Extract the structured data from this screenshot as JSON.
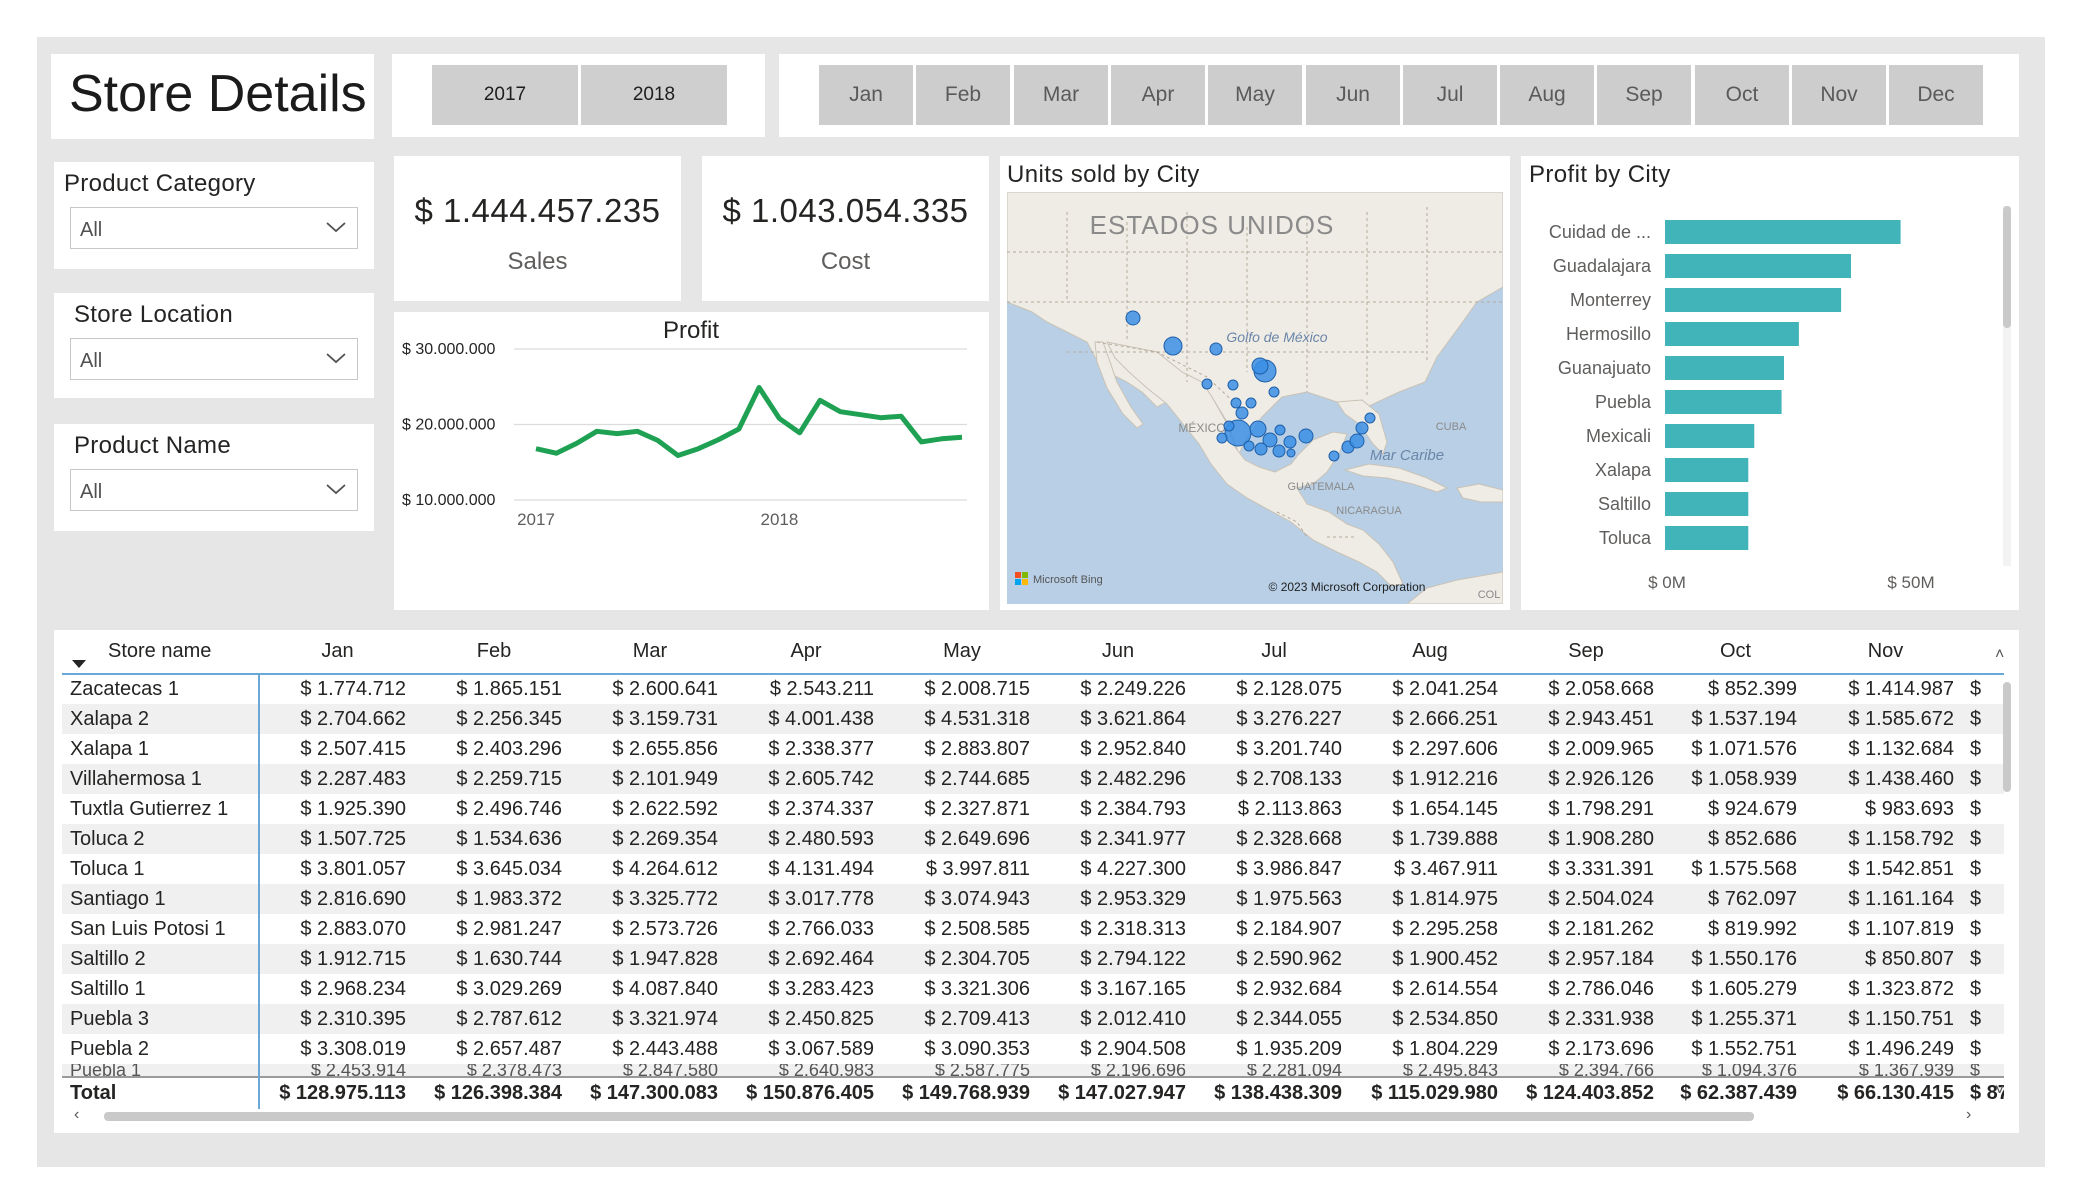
{
  "page": {
    "title": "Store Details"
  },
  "years": [
    "2017",
    "2018"
  ],
  "months": [
    "Jan",
    "Feb",
    "Mar",
    "Apr",
    "May",
    "Jun",
    "Jul",
    "Aug",
    "Sep",
    "Oct",
    "Nov",
    "Dec"
  ],
  "slicers": {
    "category": {
      "title": "Product Category",
      "value": "All"
    },
    "location": {
      "title": "Store Location",
      "value": "All"
    },
    "product": {
      "title": "Product Name",
      "value": "All"
    }
  },
  "kpis": {
    "sales": {
      "value": "$ 1.444.457.235",
      "label": "Sales"
    },
    "cost": {
      "value": "$ 1.043.054.335",
      "label": "Cost"
    }
  },
  "map": {
    "title": "Units sold by City",
    "labels": {
      "country_usa": "ESTADOS UNIDOS",
      "gulf": "Golfo de México",
      "mexico": "MÉXICO",
      "cuba": "CUBA",
      "caribbean": "Mar Caribe",
      "guatemala": "GUATEMALA",
      "nicaragua": "NICARAGUA",
      "col": "COL",
      "bing": "Microsoft Bing",
      "copyright": "© 2023 Microsoft Corporation"
    },
    "colors": {
      "water": "#b8cfe6",
      "land": "#efece6",
      "bubble": "#3b8fe5"
    }
  },
  "profit_chart": {
    "title": "Profit",
    "color": "#1fa154",
    "y_ticks": [
      "$ 30.000.000",
      "$ 20.000.000",
      "$ 10.000.000"
    ],
    "x_ticks": [
      "2017",
      "2018"
    ]
  },
  "city_chart": {
    "title": "Profit by City",
    "color": "#41b4ba",
    "x_ticks": [
      "$ 0M",
      "$ 50M"
    ]
  },
  "chart_data": [
    {
      "type": "line",
      "title": "Profit",
      "xlabel": "",
      "ylabel": "",
      "x": [
        "2017-01",
        "2017-02",
        "2017-03",
        "2017-04",
        "2017-05",
        "2017-06",
        "2017-07",
        "2017-08",
        "2017-09",
        "2017-10",
        "2017-11",
        "2017-12",
        "2018-01",
        "2018-02",
        "2018-03",
        "2018-04",
        "2018-05",
        "2018-06",
        "2018-07",
        "2018-08",
        "2018-09",
        "2018-10"
      ],
      "series": [
        {
          "values": [
            16800000,
            16200000,
            17500000,
            19100000,
            18800000,
            19100000,
            17900000,
            15900000,
            16800000,
            18000000,
            19400000,
            24900000,
            20800000,
            18900000,
            23200000,
            21700000,
            21300000,
            20900000,
            21100000,
            17700000,
            18100000,
            18300000
          ]
        }
      ],
      "ylim": [
        10000000,
        30000000
      ],
      "grid": true
    },
    {
      "type": "bar",
      "orientation": "horizontal",
      "title": "Profit by City",
      "categories": [
        "Cuidad de ...",
        "Guadalajara",
        "Monterrey",
        "Hermosillo",
        "Guanajuato",
        "Puebla",
        "Mexicali",
        "Xalapa",
        "Saltillo",
        "Toluca"
      ],
      "values": [
        47500000,
        37500000,
        35500000,
        27000000,
        24000000,
        23500000,
        18000000,
        16800000,
        16800000,
        16800000
      ],
      "xlim": [
        0,
        60000000
      ]
    }
  ],
  "table": {
    "name_header": "Store name",
    "months": [
      "Jan",
      "Feb",
      "Mar",
      "Apr",
      "May",
      "Jun",
      "Jul",
      "Aug",
      "Sep",
      "Oct",
      "Nov"
    ],
    "rows": [
      {
        "name": "Zacatecas 1",
        "values": [
          "$ 1.774.712",
          "$ 1.865.151",
          "$ 2.600.641",
          "$ 2.543.211",
          "$ 2.008.715",
          "$ 2.249.226",
          "$ 2.128.075",
          "$ 2.041.254",
          "$ 2.058.668",
          "$ 852.399",
          "$ 1.414.987"
        ]
      },
      {
        "name": "Xalapa 2",
        "values": [
          "$ 2.704.662",
          "$ 2.256.345",
          "$ 3.159.731",
          "$ 4.001.438",
          "$ 4.531.318",
          "$ 3.621.864",
          "$ 3.276.227",
          "$ 2.666.251",
          "$ 2.943.451",
          "$ 1.537.194",
          "$ 1.585.672"
        ]
      },
      {
        "name": "Xalapa 1",
        "values": [
          "$ 2.507.415",
          "$ 2.403.296",
          "$ 2.655.856",
          "$ 2.338.377",
          "$ 2.883.807",
          "$ 2.952.840",
          "$ 3.201.740",
          "$ 2.297.606",
          "$ 2.009.965",
          "$ 1.071.576",
          "$ 1.132.684"
        ]
      },
      {
        "name": "Villahermosa 1",
        "values": [
          "$ 2.287.483",
          "$ 2.259.715",
          "$ 2.101.949",
          "$ 2.605.742",
          "$ 2.744.685",
          "$ 2.482.296",
          "$ 2.708.133",
          "$ 1.912.216",
          "$ 2.926.126",
          "$ 1.058.939",
          "$ 1.438.460"
        ]
      },
      {
        "name": "Tuxtla Gutierrez 1",
        "values": [
          "$ 1.925.390",
          "$ 2.496.746",
          "$ 2.622.592",
          "$ 2.374.337",
          "$ 2.327.871",
          "$ 2.384.793",
          "$ 2.113.863",
          "$ 1.654.145",
          "$ 1.798.291",
          "$ 924.679",
          "$ 983.693"
        ]
      },
      {
        "name": "Toluca 2",
        "values": [
          "$ 1.507.725",
          "$ 1.534.636",
          "$ 2.269.354",
          "$ 2.480.593",
          "$ 2.649.696",
          "$ 2.341.977",
          "$ 2.328.668",
          "$ 1.739.888",
          "$ 1.908.280",
          "$ 852.686",
          "$ 1.158.792"
        ]
      },
      {
        "name": "Toluca 1",
        "values": [
          "$ 3.801.057",
          "$ 3.645.034",
          "$ 4.264.612",
          "$ 4.131.494",
          "$ 3.997.811",
          "$ 4.227.300",
          "$ 3.986.847",
          "$ 3.467.911",
          "$ 3.331.391",
          "$ 1.575.568",
          "$ 1.542.851"
        ]
      },
      {
        "name": "Santiago 1",
        "values": [
          "$ 2.816.690",
          "$ 1.983.372",
          "$ 3.325.772",
          "$ 3.017.778",
          "$ 3.074.943",
          "$ 2.953.329",
          "$ 1.975.563",
          "$ 1.814.975",
          "$ 2.504.024",
          "$ 762.097",
          "$ 1.161.164"
        ]
      },
      {
        "name": "San Luis Potosi 1",
        "values": [
          "$ 2.883.070",
          "$ 2.981.247",
          "$ 2.573.726",
          "$ 2.766.033",
          "$ 2.508.585",
          "$ 2.318.313",
          "$ 2.184.907",
          "$ 2.295.258",
          "$ 2.181.262",
          "$ 819.992",
          "$ 1.107.819"
        ]
      },
      {
        "name": "Saltillo 2",
        "values": [
          "$ 1.912.715",
          "$ 1.630.744",
          "$ 1.947.828",
          "$ 2.692.464",
          "$ 2.304.705",
          "$ 2.794.122",
          "$ 2.590.962",
          "$ 1.900.452",
          "$ 2.957.184",
          "$ 1.550.176",
          "$ 850.807"
        ]
      },
      {
        "name": "Saltillo 1",
        "values": [
          "$ 2.968.234",
          "$ 3.029.269",
          "$ 4.087.840",
          "$ 3.283.423",
          "$ 3.321.306",
          "$ 3.167.165",
          "$ 2.932.684",
          "$ 2.614.554",
          "$ 2.786.046",
          "$ 1.605.279",
          "$ 1.323.872"
        ]
      },
      {
        "name": "Puebla 3",
        "values": [
          "$ 2.310.395",
          "$ 2.787.612",
          "$ 3.321.974",
          "$ 2.450.825",
          "$ 2.709.413",
          "$ 2.012.410",
          "$ 2.344.055",
          "$ 2.534.850",
          "$ 2.331.938",
          "$ 1.255.371",
          "$ 1.150.751"
        ]
      },
      {
        "name": "Puebla 2",
        "values": [
          "$ 3.308.019",
          "$ 2.657.487",
          "$ 2.443.488",
          "$ 3.067.589",
          "$ 3.090.353",
          "$ 2.904.508",
          "$ 1.935.209",
          "$ 1.804.229",
          "$ 2.173.696",
          "$ 1.552.751",
          "$ 1.496.249"
        ]
      }
    ],
    "partial_row": {
      "name": "Puebla 1",
      "values": [
        "$ 2.453.914",
        "$ 2.378.473",
        "$ 2.847.580",
        "$ 2.640.983",
        "$ 2.587.775",
        "$ 2.196.696",
        "$ 2.281.094",
        "$ 2.495.843",
        "$ 2.394.766",
        "$ 1.094.376",
        "$ 1.367.939"
      ]
    },
    "last_col_glyph": "$",
    "total": {
      "label": "Total",
      "values": [
        "$ 128.975.113",
        "$ 126.398.384",
        "$ 147.300.083",
        "$ 150.876.405",
        "$ 149.768.939",
        "$ 147.027.947",
        "$ 138.438.309",
        "$ 115.029.980",
        "$ 124.403.852",
        "$ 62.387.439",
        "$ 66.130.415"
      ],
      "last_fragment": "$ 87"
    }
  }
}
